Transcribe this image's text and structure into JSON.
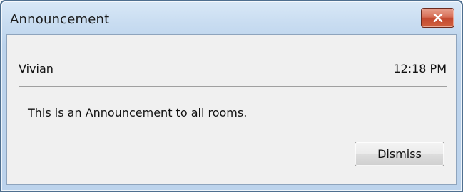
{
  "window": {
    "title": "Announcement"
  },
  "announcement": {
    "sender": "Vivian",
    "time": "12:18 PM",
    "message": "This is an Announcement to all rooms."
  },
  "actions": {
    "dismiss_label": "Dismiss"
  },
  "icons": {
    "close": "close-icon"
  },
  "colors": {
    "close_button": "#d0613f",
    "titlebar": "#c9ddf1",
    "client_background": "#f0f0f0"
  }
}
